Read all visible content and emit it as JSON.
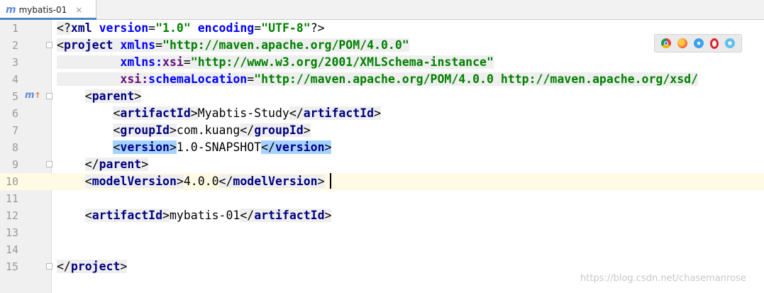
{
  "tab": {
    "icon": "m-icon",
    "label": "mybatis-01",
    "close": "×"
  },
  "editor": {
    "current_line": 10,
    "lines": [
      {
        "num": "1"
      },
      {
        "num": "2"
      },
      {
        "num": "3"
      },
      {
        "num": "4"
      },
      {
        "num": "5"
      },
      {
        "num": "6"
      },
      {
        "num": "7"
      },
      {
        "num": "8"
      },
      {
        "num": "9"
      },
      {
        "num": "10"
      },
      {
        "num": "11"
      },
      {
        "num": "12"
      },
      {
        "num": "13"
      },
      {
        "num": "14"
      },
      {
        "num": "15"
      }
    ],
    "code": {
      "l1": {
        "open": "<?",
        "name": "xml",
        "attr1": "version",
        "val1": "\"1.0\"",
        "attr2": "encoding",
        "val2": "\"UTF-8\"",
        "close": "?>"
      },
      "l2": {
        "open": "<",
        "tag": "project",
        "attr": "xmlns",
        "eq": "=",
        "val": "\"http://maven.apache.org/POM/4.0.0\""
      },
      "l3": {
        "attr_prefix": "xmlns:",
        "attr_name": "xsi",
        "eq": "=",
        "val": "\"http://www.w3.org/2001/XMLSchema-instance\""
      },
      "l4": {
        "attr_prefix": "xsi:",
        "attr_name": "schemaLocation",
        "eq": "=",
        "val": "\"http://maven.apache.org/POM/4.0.0 http://maven.apache.org/xsd/"
      },
      "l5": {
        "open": "<",
        "tag": "parent",
        "close": ">"
      },
      "l6": {
        "open": "<",
        "tag": "artifactId",
        "close": ">",
        "text": "Myabtis-Study",
        "end_open": "</",
        "end_tag": "artifactId",
        "end_close": ">"
      },
      "l7": {
        "open": "<",
        "tag": "groupId",
        "close": ">",
        "text": "com.kuang",
        "end_open": "</",
        "end_tag": "groupId",
        "end_close": ">"
      },
      "l8": {
        "open": "<",
        "tag": "version",
        "close": ">",
        "text": "1.0-SNAPSHOT",
        "end_open": "</",
        "end_tag": "version",
        "end_close": ">"
      },
      "l9": {
        "open": "</",
        "tag": "parent",
        "close": ">"
      },
      "l10": {
        "open": "<",
        "tag": "modelVersion",
        "close": ">",
        "text": "4.0.0",
        "end_open": "</",
        "end_tag": "modelVersion",
        "end_close": ">"
      },
      "l12": {
        "open": "<",
        "tag": "artifactId",
        "close": ">",
        "text": "mybatis-01",
        "end_open": "</",
        "end_tag": "artifactId",
        "end_close": ">"
      },
      "l15": {
        "open": "</",
        "tag": "project",
        "close": ">"
      }
    }
  },
  "browser_icons": [
    "chrome-icon",
    "firefox-icon",
    "safari-icon",
    "opera-icon",
    "ie-icon"
  ],
  "watermark": "https://blog.csdn.net/chasemanrose",
  "colors": {
    "tag": "#000080",
    "attr": "#0000ff",
    "namespace": "#660e7a",
    "value": "#008000",
    "highlight": "#a6d2ff",
    "current_line": "#fffae3"
  }
}
